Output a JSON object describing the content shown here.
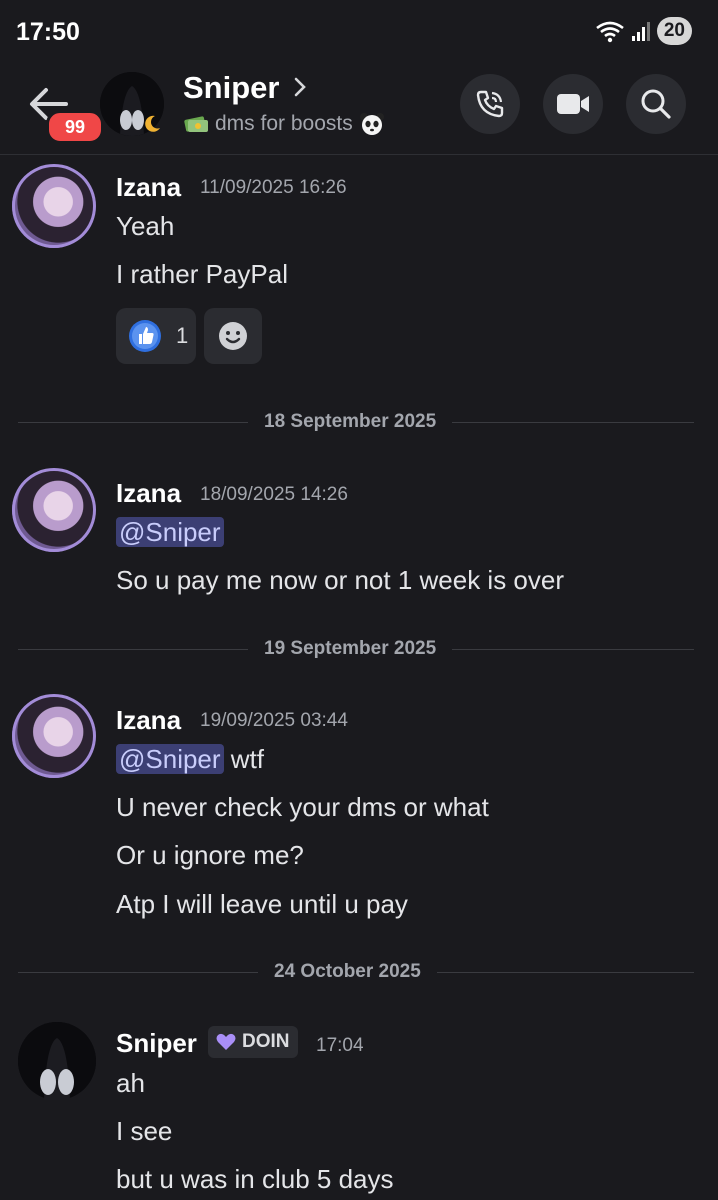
{
  "status_bar": {
    "time": "17:50",
    "battery": "20"
  },
  "header": {
    "back_badge": "99",
    "name": "Sniper",
    "status": "dms for boosts"
  },
  "messages": [
    {
      "author": "Izana",
      "timestamp": "11/09/2025 16:26",
      "lines": [
        "Yeah",
        "I rather PayPal"
      ],
      "reaction_count": "1"
    },
    {
      "divider": "18 September 2025"
    },
    {
      "author": "Izana",
      "timestamp": "18/09/2025 14:26",
      "mention": "@Sniper",
      "lines": [
        "So u pay me now or not 1 week is over"
      ]
    },
    {
      "divider": "19 September 2025"
    },
    {
      "author": "Izana",
      "timestamp": "19/09/2025 03:44",
      "mention": "@Sniper",
      "mention_suffix": "wtf",
      "lines": [
        "U never check your dms or what",
        "Or u ignore me?",
        "Atp I will leave until u pay"
      ]
    },
    {
      "divider": "24 October 2025"
    },
    {
      "author": "Sniper",
      "role_tag": "DOIN",
      "timestamp": "17:04",
      "lines": [
        "ah",
        "I see",
        "but u was in club 5 days"
      ]
    }
  ],
  "colors": {
    "mention_bg": "#3c3f74",
    "badge": "#f04747",
    "reaction_accent": "#2f6fdf",
    "role_heart": "#a98ff7"
  }
}
